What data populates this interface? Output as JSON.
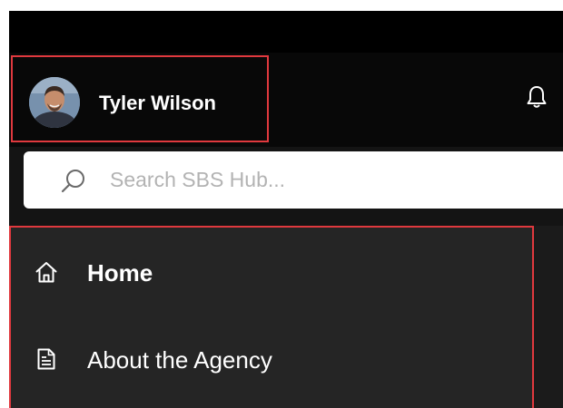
{
  "user": {
    "name": "Tyler Wilson",
    "avatar_icon": "user-photo-avatar"
  },
  "header": {
    "notification_icon": "bell-icon"
  },
  "search": {
    "placeholder": "Search SBS Hub...",
    "value": "",
    "icon": "search-icon"
  },
  "nav": {
    "items": [
      {
        "label": "Home",
        "icon": "home-icon",
        "active": true
      },
      {
        "label": "About the Agency",
        "icon": "document-icon",
        "active": false
      }
    ]
  },
  "colors": {
    "highlight_border": "#e0393e",
    "header_bg": "#080808",
    "nav_bg": "#252525",
    "text": "#ffffff"
  }
}
